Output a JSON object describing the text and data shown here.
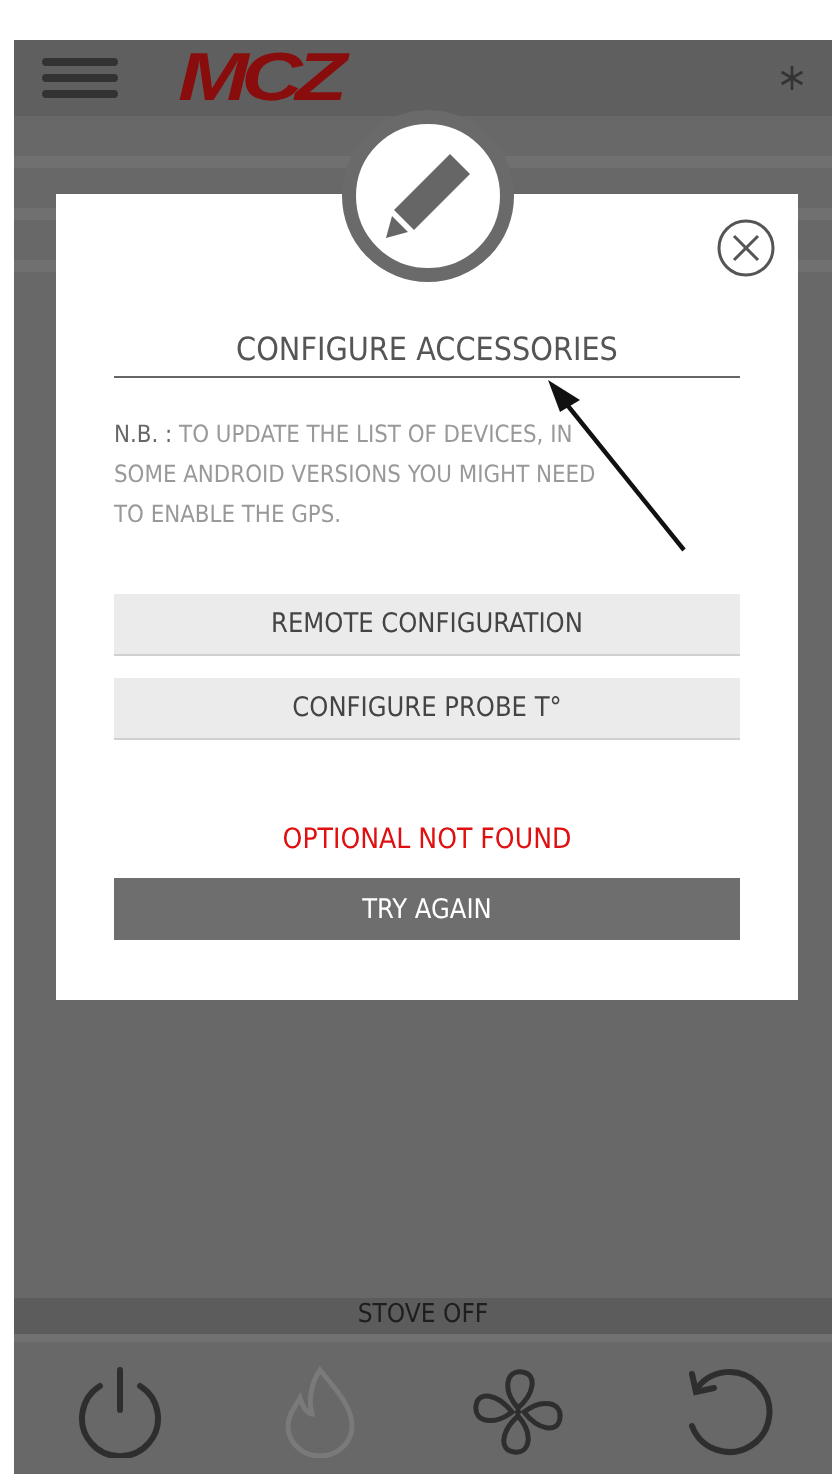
{
  "header": {
    "logo": "MCZ"
  },
  "dialog": {
    "title": "CONFIGURE ACCESSORIES",
    "note": "**N.B. :** TO UPDATE THE LIST OF DEVICES, IN SOME ANDROID VERSIONS YOU MIGHT NEED TO ENABLE THE GPS.",
    "buttons": [
      {
        "label": "REMOTE CONFIGURATION",
        "kind": "secondary"
      },
      {
        "label": "CONFIGURE PROBE T°",
        "kind": "secondary"
      },
      {
        "label": "TRY AGAIN",
        "kind": "primary"
      }
    ],
    "error": "OPTIONAL NOT FOUND"
  },
  "status_bar": "STOVE OFF",
  "toolbar": [
    {
      "kind": "power",
      "disabled": false
    },
    {
      "kind": "flame",
      "disabled": true
    },
    {
      "kind": "fan",
      "disabled": false
    },
    {
      "kind": "refresh",
      "disabled": false
    }
  ]
}
